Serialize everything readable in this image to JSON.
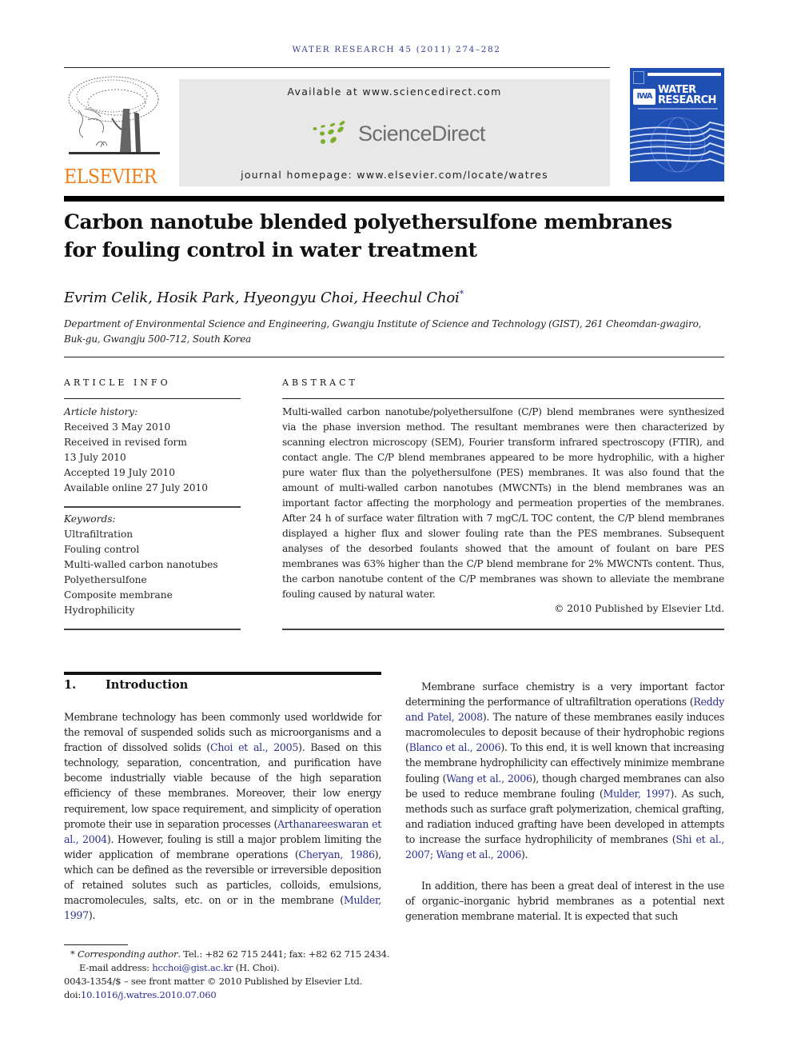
{
  "journal_header": {
    "running_head": "WATER RESEARCH 45 (2011) 274–282",
    "publisher_logo_text": "ELSEVIER",
    "available_at": "Available at www.sciencedirect.com",
    "sciencedirect_label": "ScienceDirect",
    "journal_homepage": "journal homepage: www.elsevier.com/locate/watres",
    "cover": {
      "badge": "IWA",
      "title_line1": "WATER",
      "title_line2": "RESEARCH"
    },
    "colors": {
      "elsevier_orange": "#f07f1a",
      "sciencedirect_green": "#7cae2a",
      "cover_blue": "#1f4fb2",
      "link_blue": "#2b2f8f"
    }
  },
  "article": {
    "title_line1": "Carbon nanotube blended polyethersulfone membranes",
    "title_line2": "for fouling control in water treatment",
    "authors": "Evrim Celik, Hosik Park, Hyeongyu Choi, Heechul Choi",
    "corresponding_marker": "*",
    "affiliation_line1": "Department of Environmental Science and Engineering, Gwangju Institute of Science and Technology (GIST), 261 Cheomdan-gwagiro,",
    "affiliation_line2": "Buk-gu, Gwangju 500-712, South Korea"
  },
  "article_info": {
    "heading": "ARTICLE INFO",
    "history_label": "Article history:",
    "history": [
      "Received 3 May 2010",
      "Received in revised form",
      "13 July 2010",
      "Accepted 19 July 2010",
      "Available online 27 July 2010"
    ],
    "keywords_label": "Keywords:",
    "keywords": [
      "Ultrafiltration",
      "Fouling control",
      "Multi-walled carbon nanotubes",
      "Polyethersulfone",
      "Composite membrane",
      "Hydrophilicity"
    ]
  },
  "abstract": {
    "heading": "ABSTRACT",
    "text": "Multi-walled carbon nanotube/polyethersulfone (C/P) blend membranes were synthesized via the phase inversion method. The resultant membranes were then characterized by scanning electron microscopy (SEM), Fourier transform infrared spectroscopy (FTIR), and contact angle. The C/P blend membranes appeared to be more hydrophilic, with a higher pure water flux than the polyethersulfone (PES) membranes. It was also found that the amount of multi-walled carbon nanotubes (MWCNTs) in the blend membranes was an important factor affecting the morphology and permeation properties of the membranes. After 24 h of surface water filtration with 7 mgC/L TOC content, the C/P blend membranes displayed a higher flux and slower fouling rate than the PES membranes. Subsequent analyses of the desorbed foulants showed that the amount of foulant on bare PES membranes was 63% higher than the C/P blend membrane for 2% MWCNTs content. Thus, the carbon nanotube content of the C/P membranes was shown to alleviate the membrane fouling caused by natural water.",
    "copyright": "© 2010 Published by Elsevier Ltd."
  },
  "introduction": {
    "number": "1.",
    "heading": "Introduction",
    "left_para": {
      "t1": "Membrane technology has been commonly used worldwide for the removal of suspended solids such as microorganisms and a fraction of dissolved solids (",
      "c1": "Choi et al., 2005",
      "t2": "). Based on this technology, separation, concentration, and purification have become industrially viable because of the high separation efficiency of these membranes. Moreover, their low energy requirement, low space requirement, and simplicity of operation promote their use in separation processes (",
      "c2": "Arthanareeswaran et al., 2004",
      "t3": "). However, fouling is still a major problem limiting the wider application of membrane operations (",
      "c3": "Cheryan, 1986",
      "t4": "), which can be defined as the reversible or irreversible deposition of retained solutes such as particles, colloids, emulsions, macromolecules, salts, etc. on or in the membrane (",
      "c4": "Mulder, 1997",
      "t5": ")."
    },
    "right_para1": {
      "t1": "Membrane surface chemistry is a very important factor determining the performance of ultrafiltration operations (",
      "c1": "Reddy and Patel, 2008",
      "t2": "). The nature of these membranes easily induces macromolecules to deposit because of their hydrophobic regions (",
      "c2": "Blanco et al., 2006",
      "t3": "). To this end, it is well known that increasing the membrane hydrophilicity can effectively minimize membrane fouling (",
      "c3": "Wang et al., 2006",
      "t4": "), though charged membranes can also be used to reduce membrane fouling (",
      "c4": "Mulder, 1997",
      "t5": "). As such, methods such as surface graft polymerization, chemical grafting, and radiation induced grafting have been developed in attempts to increase the surface hydrophilicity of membranes (",
      "c5": "Shi et al., 2007; Wang et al., 2006",
      "t6": ")."
    },
    "right_para2": "In addition, there has been a great deal of interest in the use of organic–inorganic hybrid membranes as a potential next generation membrane material. It is expected that such"
  },
  "footnotes": {
    "marker": "*",
    "corresponding_label": "Corresponding author",
    "contact": ". Tel.: +82 62 715 2441; fax: +82 62 715 2434.",
    "email_label": "E-mail address: ",
    "email": "hcchoi@gist.ac.kr",
    "email_suffix": " (H. Choi).",
    "front_matter": "0043-1354/$ – see front matter © 2010 Published by Elsevier Ltd.",
    "doi_label": "doi:",
    "doi": "10.1016/j.watres.2010.07.060"
  }
}
